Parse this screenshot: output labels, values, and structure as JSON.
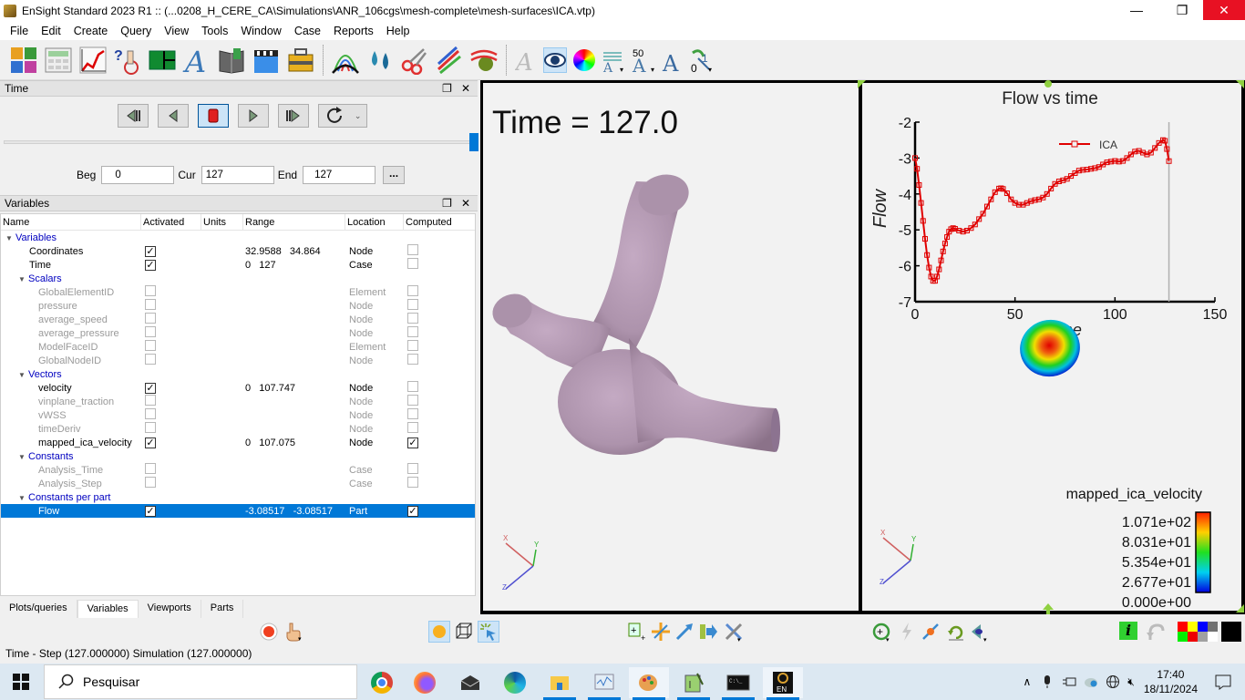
{
  "window": {
    "title": "EnSight Standard 2023 R1 ::  (...0208_H_CERE_CA\\Simulations\\ANR_106cgs\\mesh-complete\\mesh-surfaces\\ICA.vtp)",
    "minimize_icon": "minimize-icon",
    "restore_icon": "restore-icon",
    "close_icon": "close-icon",
    "min_glyph": "—",
    "restore_glyph": "❐",
    "close_glyph": "✕"
  },
  "menu": [
    "File",
    "Edit",
    "Create",
    "Query",
    "View",
    "Tools",
    "Window",
    "Case",
    "Reports",
    "Help"
  ],
  "toolbar": {
    "icons": [
      "parts-puzzle-icon",
      "calculator-icon",
      "plot-icon",
      "query-probe-icon",
      "viewports-icon",
      "annotation-text-icon",
      "user-manual-book-icon",
      "animation-clapper-icon",
      "toolbox-icon",
      "isosurface-contour-icon",
      "particle-trace-icon",
      "clip-scissors-icon",
      "vector-arrows-icon",
      "flow-sphere-icon"
    ],
    "icons2": [
      "text-annotation-icon",
      "visibility-eye-icon",
      "color-palette-icon",
      "legend-text-icon",
      "font-size-icon",
      "font-style-icon",
      "number-format-icon"
    ],
    "font_size_label": "50",
    "number_label": "0"
  },
  "time_panel": {
    "title": "Time",
    "beg_label": "Beg",
    "beg_value": "0",
    "cur_label": "Cur",
    "cur_value": "127",
    "end_label": "End",
    "end_value": "127",
    "more_label": "...",
    "slider_fraction": 1.0,
    "buttons": [
      "first-step",
      "step-back",
      "stop",
      "step-forward",
      "last-step",
      "loop-mode"
    ]
  },
  "variables_panel": {
    "title": "Variables",
    "columns": [
      "Name",
      "Activated",
      "Units",
      "Range",
      "Location",
      "Computed"
    ],
    "rows": [
      {
        "type": "group",
        "level": 0,
        "name": "Variables"
      },
      {
        "type": "item",
        "level": 1,
        "name": "Coordinates",
        "activated": true,
        "range": "32.9588   34.864",
        "location": "Node",
        "computed": false,
        "enabled": true
      },
      {
        "type": "item",
        "level": 1,
        "name": "Time",
        "activated": true,
        "range": "0   127",
        "location": "Case",
        "computed": false,
        "enabled": true
      },
      {
        "type": "group",
        "level": 1,
        "name": "Scalars"
      },
      {
        "type": "item",
        "level": 2,
        "name": "GlobalElementID",
        "activated": false,
        "range": "",
        "location": "Element",
        "computed": false,
        "enabled": false
      },
      {
        "type": "item",
        "level": 2,
        "name": "pressure",
        "activated": false,
        "range": "",
        "location": "Node",
        "computed": false,
        "enabled": false
      },
      {
        "type": "item",
        "level": 2,
        "name": "average_speed",
        "activated": false,
        "range": "",
        "location": "Node",
        "computed": false,
        "enabled": false
      },
      {
        "type": "item",
        "level": 2,
        "name": "average_pressure",
        "activated": false,
        "range": "",
        "location": "Node",
        "computed": false,
        "enabled": false
      },
      {
        "type": "item",
        "level": 2,
        "name": "ModelFaceID",
        "activated": false,
        "range": "",
        "location": "Element",
        "computed": false,
        "enabled": false
      },
      {
        "type": "item",
        "level": 2,
        "name": "GlobalNodeID",
        "activated": false,
        "range": "",
        "location": "Node",
        "computed": false,
        "enabled": false
      },
      {
        "type": "group",
        "level": 1,
        "name": "Vectors"
      },
      {
        "type": "item",
        "level": 2,
        "name": "velocity",
        "activated": true,
        "range": "0   107.747",
        "location": "Node",
        "computed": false,
        "enabled": true
      },
      {
        "type": "item",
        "level": 2,
        "name": "vinplane_traction",
        "activated": false,
        "range": "",
        "location": "Node",
        "computed": false,
        "enabled": false
      },
      {
        "type": "item",
        "level": 2,
        "name": "vWSS",
        "activated": false,
        "range": "",
        "location": "Node",
        "computed": false,
        "enabled": false
      },
      {
        "type": "item",
        "level": 2,
        "name": "timeDeriv",
        "activated": false,
        "range": "",
        "location": "Node",
        "computed": false,
        "enabled": false
      },
      {
        "type": "item",
        "level": 2,
        "name": "mapped_ica_velocity",
        "activated": true,
        "range": "0   107.075",
        "location": "Node",
        "computed": true,
        "enabled": true
      },
      {
        "type": "group",
        "level": 1,
        "name": "Constants"
      },
      {
        "type": "item",
        "level": 2,
        "name": "Analysis_Time",
        "activated": false,
        "range": "",
        "location": "Case",
        "computed": false,
        "enabled": false
      },
      {
        "type": "item",
        "level": 2,
        "name": "Analysis_Step",
        "activated": false,
        "range": "",
        "location": "Case",
        "computed": false,
        "enabled": false
      },
      {
        "type": "group",
        "level": 1,
        "name": "Constants per part"
      },
      {
        "type": "item",
        "level": 2,
        "name": "Flow",
        "activated": true,
        "range": "-3.08517   -3.08517",
        "location": "Part",
        "computed": true,
        "enabled": true,
        "selected": true
      }
    ]
  },
  "bottom_tabs": [
    {
      "label": "Plots/queries",
      "active": false
    },
    {
      "label": "Variables",
      "active": true
    },
    {
      "label": "Viewports",
      "active": false
    },
    {
      "label": "Parts",
      "active": false
    }
  ],
  "viewport1": {
    "time_annotation": "Time = 127.0",
    "model_color": "#b69ab5",
    "axis_labels": [
      "X",
      "Y",
      "Z"
    ]
  },
  "viewport2": {
    "legend_title": "mapped_ica_velocity",
    "legend_ticks": [
      "1.071e+02",
      "8.031e+01",
      "5.354e+01",
      "2.677e+01",
      "0.000e+00"
    ],
    "axis_labels": [
      "X",
      "Y",
      "Z"
    ]
  },
  "chart_data": {
    "type": "line",
    "title": "Flow vs time",
    "xlabel": "Time",
    "ylabel": "Flow",
    "xlim": [
      0,
      150
    ],
    "ylim": [
      -7,
      -2
    ],
    "xticks": [
      "0",
      "50",
      "100",
      "150"
    ],
    "yticks": [
      "-2",
      "-3",
      "-4",
      "-5",
      "-6",
      "-7"
    ],
    "grid": false,
    "legend_position": "top-right",
    "current_time_marker": 127,
    "series": [
      {
        "name": "ICA",
        "color": "#e00000",
        "marker": "square",
        "x": [
          0,
          1,
          2,
          3,
          4,
          5,
          6,
          7,
          8,
          9,
          10,
          11,
          12,
          13,
          14,
          15,
          16,
          17,
          18,
          19,
          20,
          22,
          24,
          26,
          28,
          30,
          32,
          34,
          36,
          38,
          40,
          42,
          43,
          44,
          46,
          48,
          50,
          52,
          54,
          56,
          58,
          60,
          62,
          64,
          66,
          68,
          70,
          72,
          74,
          76,
          78,
          80,
          82,
          84,
          86,
          88,
          90,
          92,
          94,
          96,
          98,
          100,
          102,
          104,
          106,
          108,
          110,
          112,
          114,
          116,
          118,
          120,
          122,
          124,
          125,
          126,
          127
        ],
        "y": [
          -3.0,
          -3.3,
          -3.75,
          -4.25,
          -4.75,
          -5.25,
          -5.7,
          -6.05,
          -6.3,
          -6.42,
          -6.42,
          -6.3,
          -6.1,
          -5.85,
          -5.6,
          -5.38,
          -5.2,
          -5.05,
          -4.98,
          -4.95,
          -4.97,
          -5.02,
          -5.05,
          -5.02,
          -4.95,
          -4.85,
          -4.7,
          -4.55,
          -4.35,
          -4.15,
          -3.95,
          -3.85,
          -3.84,
          -3.86,
          -3.98,
          -4.15,
          -4.25,
          -4.3,
          -4.3,
          -4.25,
          -4.2,
          -4.17,
          -4.15,
          -4.1,
          -4.0,
          -3.85,
          -3.72,
          -3.65,
          -3.62,
          -3.58,
          -3.5,
          -3.42,
          -3.35,
          -3.33,
          -3.32,
          -3.3,
          -3.28,
          -3.25,
          -3.18,
          -3.12,
          -3.1,
          -3.08,
          -3.1,
          -3.08,
          -3.0,
          -2.9,
          -2.82,
          -2.8,
          -2.85,
          -2.9,
          -2.85,
          -2.72,
          -2.58,
          -2.5,
          -2.52,
          -2.75,
          -3.085
        ]
      }
    ]
  },
  "bottom_toolbar": {
    "left_icons": [
      "record-icon",
      "pointer-hand-icon",
      "lighting-icon",
      "wireframe-box-icon",
      "selection-tool-icon"
    ],
    "mid_icons": [
      "add-viewport-icon",
      "move-icon",
      "arrow-icon",
      "transfer-icon",
      "tools-icon"
    ],
    "right_icons": [
      "zoom-in-icon",
      "lightning-icon",
      "fit-icon",
      "reset-icon",
      "view-direction-icon",
      "info-icon",
      "undo-icon"
    ],
    "palette": [
      "#ff0000",
      "#ffff00",
      "#0000ff",
      "#707070",
      "#00ee00",
      "#ee0000",
      "#a0a0a0",
      "#ffffff"
    ],
    "palette_current": "#000000"
  },
  "status_text": "Time - Step (127.000000) Simulation (127.000000)",
  "taskbar": {
    "search_placeholder": "Pesquisar",
    "apps": [
      "chrome-icon",
      "firefox-icon",
      "mail-icon",
      "edge-icon",
      "file-explorer-icon",
      "task-manager-icon",
      "paint-icon",
      "notepad-icon",
      "terminal-icon",
      "ensight-icon"
    ],
    "time": "17:40",
    "date": "18/11/2024"
  }
}
